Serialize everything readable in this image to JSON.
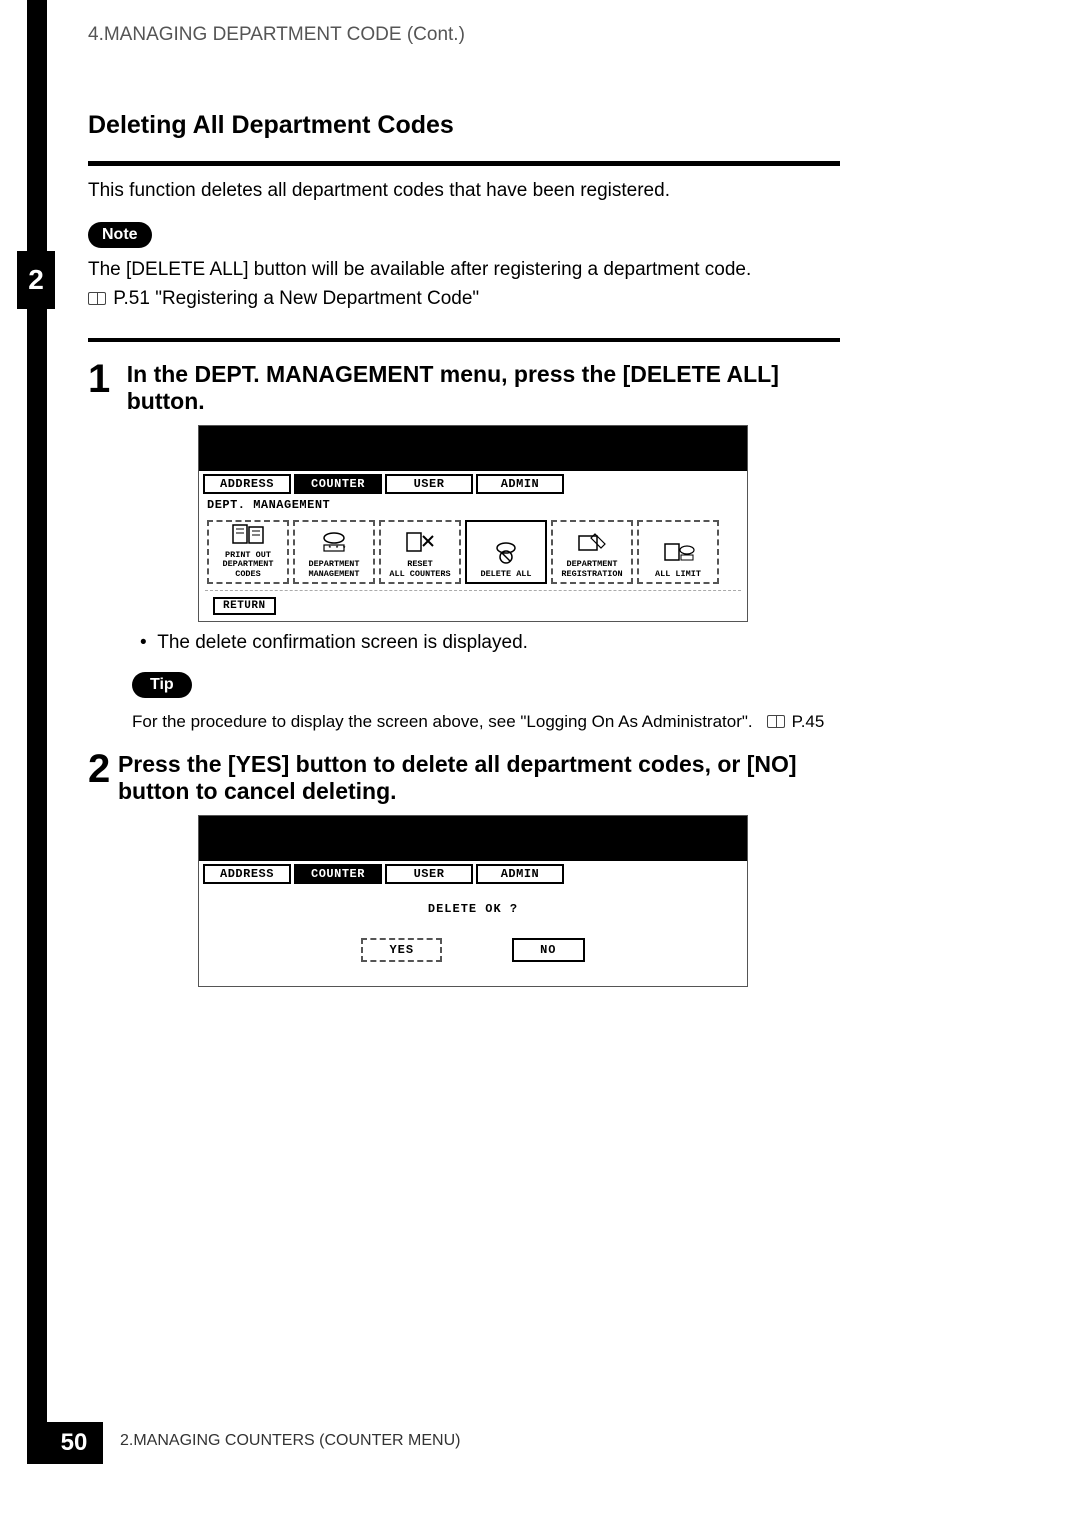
{
  "header": {
    "breadcrumb": "4.MANAGING DEPARTMENT CODE (Cont.)"
  },
  "chapter_tab": "2",
  "page_number": "50",
  "footer": "2.MANAGING COUNTERS (COUNTER MENU)",
  "section_title": "Deleting All Department Codes",
  "intro_text": "This function deletes all department codes that have been registered.",
  "note": {
    "badge": "Note",
    "line1": "The [DELETE ALL] button will be available after registering a department code.",
    "ref_text": "P.51 \"Registering a New Department Code\""
  },
  "steps": [
    {
      "num": "1",
      "text": "In the DEPT. MANAGEMENT menu, press the [DELETE ALL] button.",
      "post_bullet": "The delete confirmation screen is displayed."
    },
    {
      "num": "2",
      "text": "Press the [YES] button to delete all department codes, or [NO] button to cancel deleting."
    }
  ],
  "tip": {
    "badge": "Tip",
    "text_prefix": "For the procedure to display the screen above, see \"Logging On As Administrator\".",
    "ref": "P.45"
  },
  "screen1": {
    "tabs": [
      "ADDRESS",
      "COUNTER",
      "USER",
      "ADMIN"
    ],
    "active_tab_index": 1,
    "subtitle": "DEPT. MANAGEMENT",
    "buttons": [
      "PRINT OUT\nDEPARTMENT CODES",
      "DEPARTMENT\nMANAGEMENT",
      "RESET\nALL COUNTERS",
      "DELETE ALL",
      "DEPARTMENT\nREGISTRATION",
      "ALL LIMIT"
    ],
    "selected_button_index": 3,
    "return_label": "RETURN"
  },
  "screen2": {
    "tabs": [
      "ADDRESS",
      "COUNTER",
      "USER",
      "ADMIN"
    ],
    "active_tab_index": 1,
    "question": "DELETE OK ?",
    "yes": "YES",
    "no": "NO"
  }
}
